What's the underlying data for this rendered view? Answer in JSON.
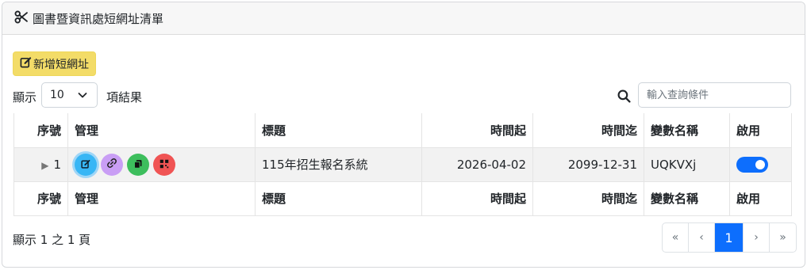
{
  "header": {
    "title": "圖書暨資訊處短網址清單",
    "icon": "scissors-icon"
  },
  "toolbar": {
    "add_label": "新增短網址",
    "add_icon": "edit-icon"
  },
  "length": {
    "show_label": "顯示",
    "value": "10",
    "suffix": "項結果"
  },
  "search": {
    "placeholder": "輸入查詢條件"
  },
  "table": {
    "columns": [
      "序號",
      "管理",
      "標題",
      "時間起",
      "時間迄",
      "變數名稱",
      "啟用"
    ],
    "rows": [
      {
        "index": "1",
        "title": "115年招生報名系統",
        "start": "2026-04-02",
        "end": "2099-12-31",
        "variable": "UQKVXj",
        "enabled": true
      }
    ]
  },
  "info": {
    "text": "顯示 1 之 1 頁"
  },
  "pagination": {
    "first": "«",
    "prev": "‹",
    "current": "1",
    "next": "›",
    "last": "»"
  },
  "colors": {
    "accent": "#0d6efd",
    "add_button": "#f3dc68",
    "edit": "#38b6f5",
    "link": "#c99ef5",
    "copy": "#3dbe5d",
    "qr": "#f05454"
  }
}
